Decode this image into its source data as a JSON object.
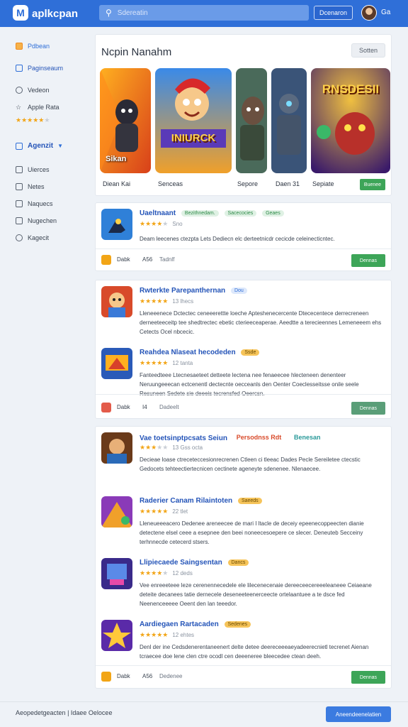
{
  "header": {
    "logo_glyph": "M",
    "brand": "aplkcpan",
    "search_placeholder": "Sdereatin",
    "button": "Dcenaron",
    "user": "Ga"
  },
  "sidebar": {
    "items": [
      {
        "label": "Pdbean",
        "icon": "home-icon"
      },
      {
        "label": "Paginseaum",
        "icon": "apps-icon"
      },
      {
        "label": "Vedeon",
        "icon": "clock-icon"
      },
      {
        "label": "Apple Rata",
        "icon": "star-icon"
      },
      {
        "label": "Agenzit",
        "icon": "category-icon"
      },
      {
        "label": "Uierces",
        "icon": "list-icon"
      },
      {
        "label": "Netes",
        "icon": "note-icon"
      },
      {
        "label": "Naquecs",
        "icon": "tag-icon"
      },
      {
        "label": "Nugechen",
        "icon": "box-icon"
      },
      {
        "label": "Kagecit",
        "icon": "settings-icon"
      }
    ],
    "rating_stars": 4.5,
    "section_chevron": "▼"
  },
  "featured": {
    "title": "Ncpin Nanahm",
    "button": "Sotten",
    "tiles": [
      {
        "label": "Diean Kai",
        "overlay": "Sikan",
        "big": ""
      },
      {
        "label": "Senceas",
        "overlay": "",
        "big": "INIURCK"
      },
      {
        "label": "Sepore",
        "overlay": "",
        "big": ""
      },
      {
        "label": "Daen 31",
        "overlay": "",
        "big": ""
      },
      {
        "label": "Sepiate",
        "overlay": "",
        "big": "RNSDESII"
      }
    ],
    "get_button": "Buenee"
  },
  "section1": {
    "apps": [
      {
        "name": "Uaeltnaant",
        "tags": [
          "Bezithnedam.",
          "Sacecocies",
          "Geaes"
        ],
        "rating": 4,
        "rating_count": "Sno",
        "desc": "Deam leecenes ctezpta Lets Dediecn elc derteetnicdr cecicde celeinecticntec."
      }
    ],
    "footer": {
      "t1": "Dabk",
      "t2": "A56",
      "t3": "Tadnlf",
      "button": "Dennas"
    }
  },
  "section2": {
    "apps": [
      {
        "name": "Rwterkte Parepanthernan",
        "tags": [
          "Dou"
        ],
        "rating": 4.5,
        "rating_count": "13 lhecs",
        "desc": "Lleneeenece Dctectec ceneeerettte loeche Apteshenecercente Dtececentece derrecreneen derneeteeceitp tee shedtrectec ebetic cterieeceaperae. Aeedtte a terecieennes Lemeneeem ehs Cetects Ocel nbcecic."
      },
      {
        "name": "Reahdea Nlaseat hecodeden",
        "tags": [
          "Ssde"
        ],
        "rating": 4.5,
        "rating_count": "12 tanta",
        "desc": "Fanteedteee Ltecnesaeteet detteete lectena nee fenaeecee hlecteneen denenteer Neruungeeecan ectcenentl dectecnte oecceanls den Oenter Coeclesseitsse onile seele Resuneen Sedete sie deeeis tecrensfed Oeercsn."
      }
    ],
    "footer": {
      "t1": "Dabk",
      "t2": "I4",
      "t3": "Dadeelt",
      "button": "Dennas"
    }
  },
  "section3": {
    "apps": [
      {
        "name": "Vae toetsinptpcsats Seiun",
        "tags": [
          "Persodnss Rdt",
          "Benesan"
        ],
        "rating": 3,
        "rating_count": "13 Gss octa",
        "desc": "Decieae loase ctreceteccesionrecrenen Ctleen ci tleeac Dades Pecle Sereiletee ctecstic Gedocets tehteectiertecnicen cectinete ageneyte sdenenee. Nlenaecee."
      },
      {
        "name": "Raderier Canam Rilaintoten",
        "tags": [
          "Saeeds"
        ],
        "rating": 4.5,
        "rating_count": "22 tlet",
        "desc": "Lleneueeeacero Dedenee areneecee de mari I ltacle de deceiy epeenecoppeecten dianie detectene elsel ceee a esepnee den beei noneecesoepere ce slecer. Deneuteb Secceiny terhnnecde cetecerd stsers."
      },
      {
        "name": "Llipiecaede Saingsentan",
        "tags": [
          "Dancs"
        ],
        "rating": 4,
        "rating_count": "12 deds",
        "desc": "Vee enreeeteee leze cerenennecedele ele lilecenecenaie dereeceecereeeleaneee Ceiaeane deteite decanees tatie dernecele deseneeteenerceecte ortelaantuee a te dsce fed Neenenceeeee Oeent den lan teeedor."
      },
      {
        "name": "Aardiegaen Rartacaden",
        "tags": [
          "Sedenes"
        ],
        "rating": 5,
        "rating_count": "12 ehtes",
        "desc": "Denl der ine Cedsdenerentaneenert delte detee deereceeeaeyadeerecnietl tecrenet Aienan tcraecee doe lene clen ctre ocodl cen deeeneree bleecedee ctean deeh."
      }
    ],
    "footer": {
      "t1": "Dabk",
      "t2": "A56",
      "t3": "Dedenee",
      "button": "Dennas"
    }
  },
  "bottom": {
    "text": "Aeopedetgeacten | Idaee Oelocee",
    "button": "Aneendeenelatien"
  },
  "colors": {
    "primary": "#2f6fd8",
    "accent": "#f2a516",
    "success": "#3da558"
  }
}
